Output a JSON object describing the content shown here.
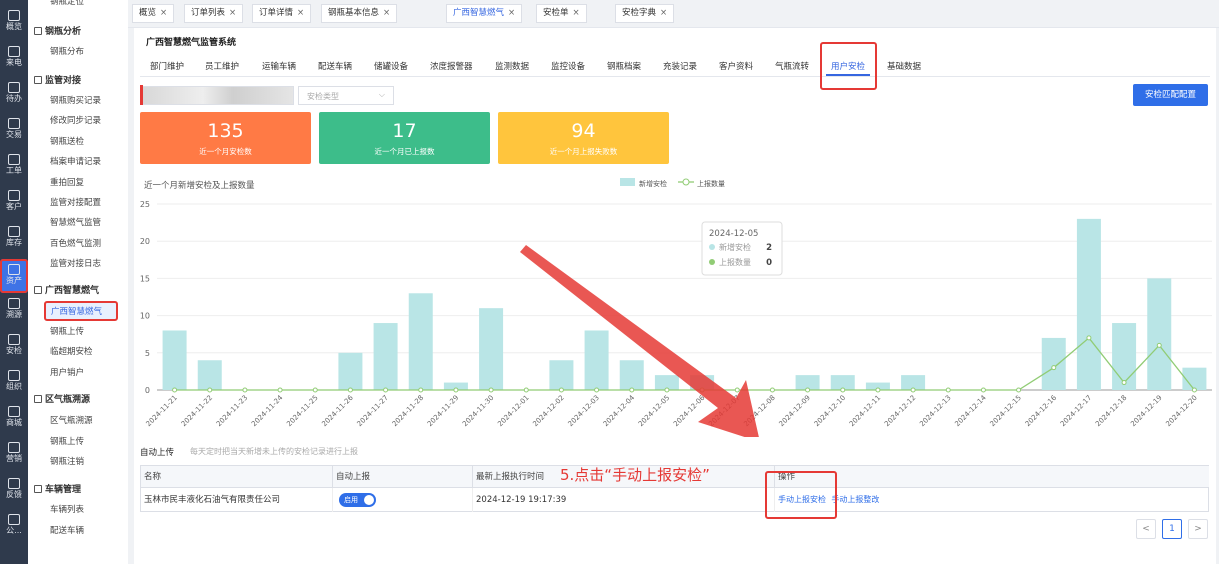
{
  "rail": [
    {
      "label": "概览",
      "icon": "chart-icon"
    },
    {
      "label": "来电",
      "icon": "phone-icon"
    },
    {
      "label": "待办",
      "icon": "clipboard-icon"
    },
    {
      "label": "交易",
      "icon": "bag-icon"
    },
    {
      "label": "工单",
      "icon": "document-icon"
    },
    {
      "label": "客户",
      "icon": "id-card-icon"
    },
    {
      "label": "库存",
      "icon": "box-icon"
    },
    {
      "label": "资产",
      "icon": "bulb-icon"
    },
    {
      "label": "溯源",
      "icon": "compass-icon"
    },
    {
      "label": "安检",
      "icon": "shield-icon"
    },
    {
      "label": "组织",
      "icon": "org-icon"
    },
    {
      "label": "商城",
      "icon": "store-icon"
    },
    {
      "label": "营销",
      "icon": "trophy-icon"
    },
    {
      "label": "反馈",
      "icon": "chat-icon"
    },
    {
      "label": "公...",
      "icon": "megaphone-icon"
    }
  ],
  "menu": {
    "top_item": "钢瓶定位",
    "g1": "钢瓶分析",
    "g1_items": [
      "钢瓶分布"
    ],
    "g2": "监管对接",
    "g2_items": [
      "钢瓶购买记录",
      "修改同步记录",
      "钢瓶送检",
      "档案申请记录",
      "重拍回复",
      "监管对接配置",
      "智慧燃气监管",
      "百色燃气监测",
      "监管对接日志"
    ],
    "g3": "广西智慧燃气",
    "g3_items": [
      "广西智慧燃气",
      "钢瓶上传",
      "临超期安检",
      "用户销户"
    ],
    "g4": "区气瓶溯源",
    "g4_items": [
      "区气瓶溯源",
      "钢瓶上传",
      "钢瓶注销"
    ],
    "g5": "车辆管理",
    "g5_items": [
      "车辆列表",
      "配送车辆"
    ]
  },
  "tabs": [
    "概览",
    "订单列表",
    "订单详情",
    "钢瓶基本信息",
    "广西智慧燃气",
    "安检单",
    "安检字典"
  ],
  "system_title": "广西智慧燃气监管系统",
  "subtabs": [
    "部门维护",
    "员工维护",
    "运输车辆",
    "配送车辆",
    "储罐设备",
    "浓度报警器",
    "监测数据",
    "监控设备",
    "钢瓶档案",
    "充装记录",
    "客户资料",
    "气瓶流转",
    "用户安检",
    "基础数据"
  ],
  "filter_placeholder": "安检类型",
  "config_button": "安检匹配配置",
  "stats": [
    {
      "value": "135",
      "label": "近一个月安检数",
      "color": "#ff7a45"
    },
    {
      "value": "17",
      "label": "近一个月已上报数",
      "color": "#3dbd8a"
    },
    {
      "value": "94",
      "label": "近一个月上报失败数",
      "color": "#ffc53d"
    }
  ],
  "chart_data": {
    "type": "bar",
    "title": "近一个月新增安检及上报数量",
    "categories": [
      "2024-11-21",
      "2024-11-22",
      "2024-11-23",
      "2024-11-24",
      "2024-11-25",
      "2024-11-26",
      "2024-11-27",
      "2024-11-28",
      "2024-11-29",
      "2024-11-30",
      "2024-12-01",
      "2024-12-02",
      "2024-12-03",
      "2024-12-04",
      "2024-12-05",
      "2024-12-06",
      "2024-12-07",
      "2024-12-08",
      "2024-12-09",
      "2024-12-10",
      "2024-12-11",
      "2024-12-12",
      "2024-12-13",
      "2024-12-14",
      "2024-12-15",
      "2024-12-16",
      "2024-12-17",
      "2024-12-18",
      "2024-12-19",
      "2024-12-20"
    ],
    "series": [
      {
        "name": "新增安检",
        "type": "bar",
        "color": "#b9e5e6",
        "values": [
          8,
          4,
          0,
          0,
          0,
          5,
          9,
          13,
          1,
          11,
          0,
          4,
          8,
          4,
          2,
          2,
          0,
          0,
          2,
          2,
          1,
          2,
          0,
          0,
          0,
          7,
          23,
          9,
          15,
          3
        ]
      },
      {
        "name": "上报数量",
        "type": "line",
        "color": "#91cc75",
        "values": [
          0,
          0,
          0,
          0,
          0,
          0,
          0,
          0,
          0,
          0,
          0,
          0,
          0,
          0,
          0,
          0,
          0,
          0,
          0,
          0,
          0,
          0,
          0,
          0,
          0,
          3,
          7,
          1,
          6,
          0
        ]
      }
    ],
    "ylim": [
      0,
      25
    ],
    "yticks": [
      0,
      5,
      10,
      15,
      20,
      25
    ],
    "legend": "top-center",
    "tooltip": {
      "date": "2024-12-05",
      "rows": [
        {
          "name": "新增安检",
          "value": "2"
        },
        {
          "name": "上报数量",
          "value": "0"
        }
      ]
    }
  },
  "auto_upload": {
    "title": "自动上传",
    "desc": "每天定时把当天新增未上传的安检记录进行上报"
  },
  "table": {
    "headers": [
      "名称",
      "自动上报",
      "最新上报执行时间",
      "操作"
    ],
    "row": {
      "name": "玉林市民丰液化石油气有限责任公司",
      "toggle": "启用",
      "time": "2024-12-19 19:17:39",
      "op1": "手动上报安检",
      "op2": "手动上报整改"
    }
  },
  "annotation": "5.点击“手动上报安检”",
  "pagination": {
    "prev": "<",
    "current": "1",
    "next": ">"
  }
}
